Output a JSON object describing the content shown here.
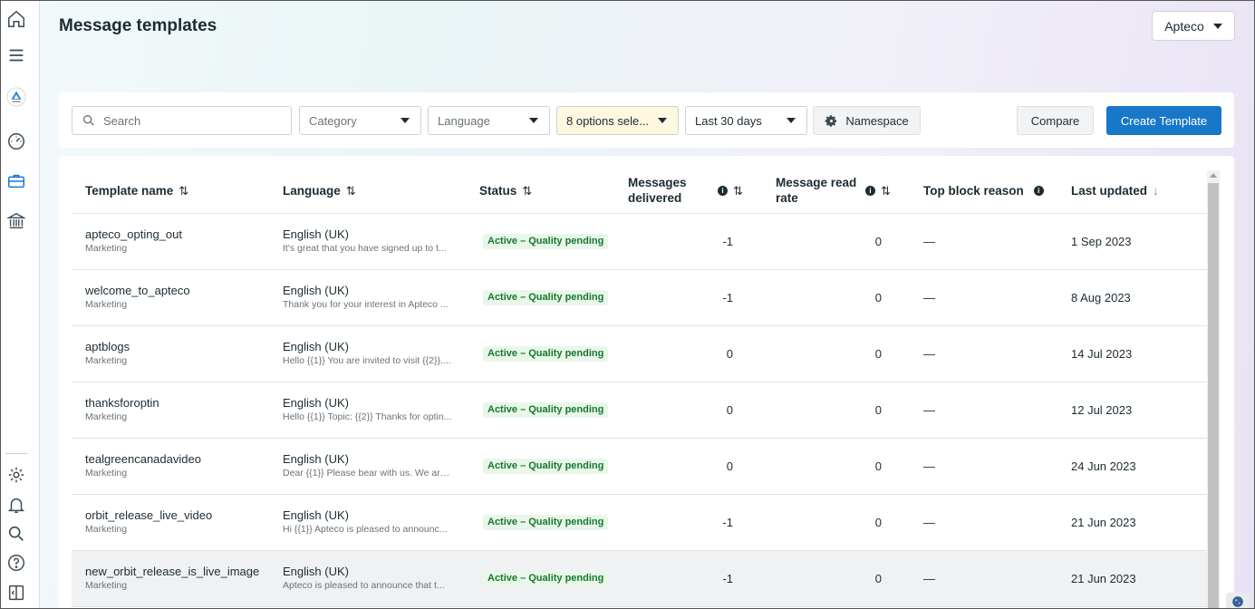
{
  "header": {
    "title": "Message templates",
    "account": "Apteco"
  },
  "sidebar": {
    "items": [
      "home-icon",
      "menu-icon",
      "apteco-logo",
      "dashboard-gauge-icon",
      "briefcase-icon",
      "institution-icon",
      "settings-icon",
      "bell-icon",
      "search-icon",
      "help-icon",
      "sidebar-toggle-icon"
    ]
  },
  "toolbar": {
    "search_placeholder": "Search",
    "category_label": "Category",
    "language_label": "Language",
    "status_filter_label": "8 options sele...",
    "date_range_label": "Last 30 days",
    "namespace_label": "Namespace",
    "compare_label": "Compare",
    "create_label": "Create Template"
  },
  "table": {
    "columns": {
      "name": "Template name",
      "language": "Language",
      "status": "Status",
      "delivered": "Messages delivered",
      "read_rate": "Message read rate",
      "block_reason": "Top block reason",
      "updated": "Last updated"
    },
    "sort_icon": "⇅",
    "sort_desc_icon": "↓",
    "rows": [
      {
        "name": "apteco_opting_out",
        "category": "Marketing",
        "language": "English (UK)",
        "preview": "It's great that you have signed up to t...",
        "status": "Active – Quality pending",
        "delivered": "-1",
        "read_rate": "0",
        "block_reason": "—",
        "updated": "1 Sep 2023"
      },
      {
        "name": "welcome_to_apteco",
        "category": "Marketing",
        "language": "English (UK)",
        "preview": "Thank you for your interest in Apteco ...",
        "status": "Active – Quality pending",
        "delivered": "-1",
        "read_rate": "0",
        "block_reason": "—",
        "updated": "8 Aug 2023"
      },
      {
        "name": "aptblogs",
        "category": "Marketing",
        "language": "English (UK)",
        "preview": "Hello {{1}} You are invited to visit {{2}}....",
        "status": "Active – Quality pending",
        "delivered": "0",
        "read_rate": "0",
        "block_reason": "—",
        "updated": "14 Jul 2023"
      },
      {
        "name": "thanksforoptin",
        "category": "Marketing",
        "language": "English (UK)",
        "preview": "Hello {{1}} Topic: {{2}} Thanks for optin...",
        "status": "Active – Quality pending",
        "delivered": "0",
        "read_rate": "0",
        "block_reason": "—",
        "updated": "12 Jul 2023"
      },
      {
        "name": "tealgreencanadavideo",
        "category": "Marketing",
        "language": "English (UK)",
        "preview": "Dear {{1}} Please bear with us. We are ...",
        "status": "Active – Quality pending",
        "delivered": "0",
        "read_rate": "0",
        "block_reason": "—",
        "updated": "24 Jun 2023"
      },
      {
        "name": "orbit_release_live_video",
        "category": "Marketing",
        "language": "English (UK)",
        "preview": "Hi {{1}} Apteco is pleased to announc...",
        "status": "Active – Quality pending",
        "delivered": "-1",
        "read_rate": "0",
        "block_reason": "—",
        "updated": "21 Jun 2023"
      },
      {
        "name": "new_orbit_release_is_live_image",
        "category": "Marketing",
        "language": "English (UK)",
        "preview": "Apteco is pleased to announce that t...",
        "status": "Active – Quality pending",
        "delivered": "-1",
        "read_rate": "0",
        "block_reason": "—",
        "updated": "21 Jun 2023"
      }
    ]
  },
  "colors": {
    "primary": "#1877c9",
    "status_text": "#157a2c",
    "status_bg": "#e9f6ea",
    "filter_highlight": "#fff7df"
  }
}
